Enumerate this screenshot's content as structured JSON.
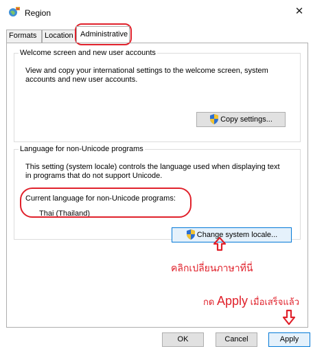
{
  "window": {
    "title": "Region",
    "close_glyph": "✕"
  },
  "tabs": [
    {
      "label": "Formats"
    },
    {
      "label": "Location"
    },
    {
      "label": "Administrative"
    }
  ],
  "welcome_group": {
    "legend": "Welcome screen and new user accounts",
    "description": "View and copy your international settings to the welcome screen, system accounts and new user accounts.",
    "copy_button_label": "Copy settings..."
  },
  "nonunicode_group": {
    "legend": "Language for non-Unicode programs",
    "description": "This setting (system locale) controls the language used when displaying text in programs that do not support Unicode.",
    "current_label": "Current language for non-Unicode programs:",
    "current_value": "Thai (Thailand)",
    "change_button_label": "Change system locale..."
  },
  "annotations": {
    "click_here": "คลิกเปลี่ยนภาษาที่นี่",
    "press_prefix": "กด ",
    "apply_word": "Apply",
    "when_done": " เมื่อเสร็จแล้ว",
    "color": "#e0202a"
  },
  "footer": {
    "ok_label": "OK",
    "cancel_label": "Cancel",
    "apply_label": "Apply"
  }
}
